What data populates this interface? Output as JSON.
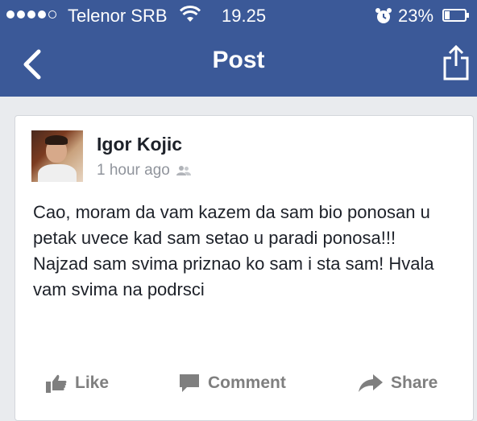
{
  "status_bar": {
    "carrier": "Telenor SRB",
    "time": "19.25",
    "battery": "23%",
    "signal_bars": 4,
    "signal_max": 5
  },
  "nav": {
    "title": "Post"
  },
  "post": {
    "author": "Igor Kojic",
    "timestamp": "1 hour ago",
    "audience_icon": "friends-icon",
    "text": "Cao, moram da vam kazem da sam bio ponosan u petak uvece kad sam setao u paradi ponosa!!! Najzad sam svima priznao ko sam i sta sam! Hvala vam svima na podrsci"
  },
  "actions": {
    "like": "Like",
    "comment": "Comment",
    "share": "Share"
  },
  "colors": {
    "brand": "#3b5998",
    "background": "#e9ebee",
    "action_text": "#7f7f7f"
  }
}
